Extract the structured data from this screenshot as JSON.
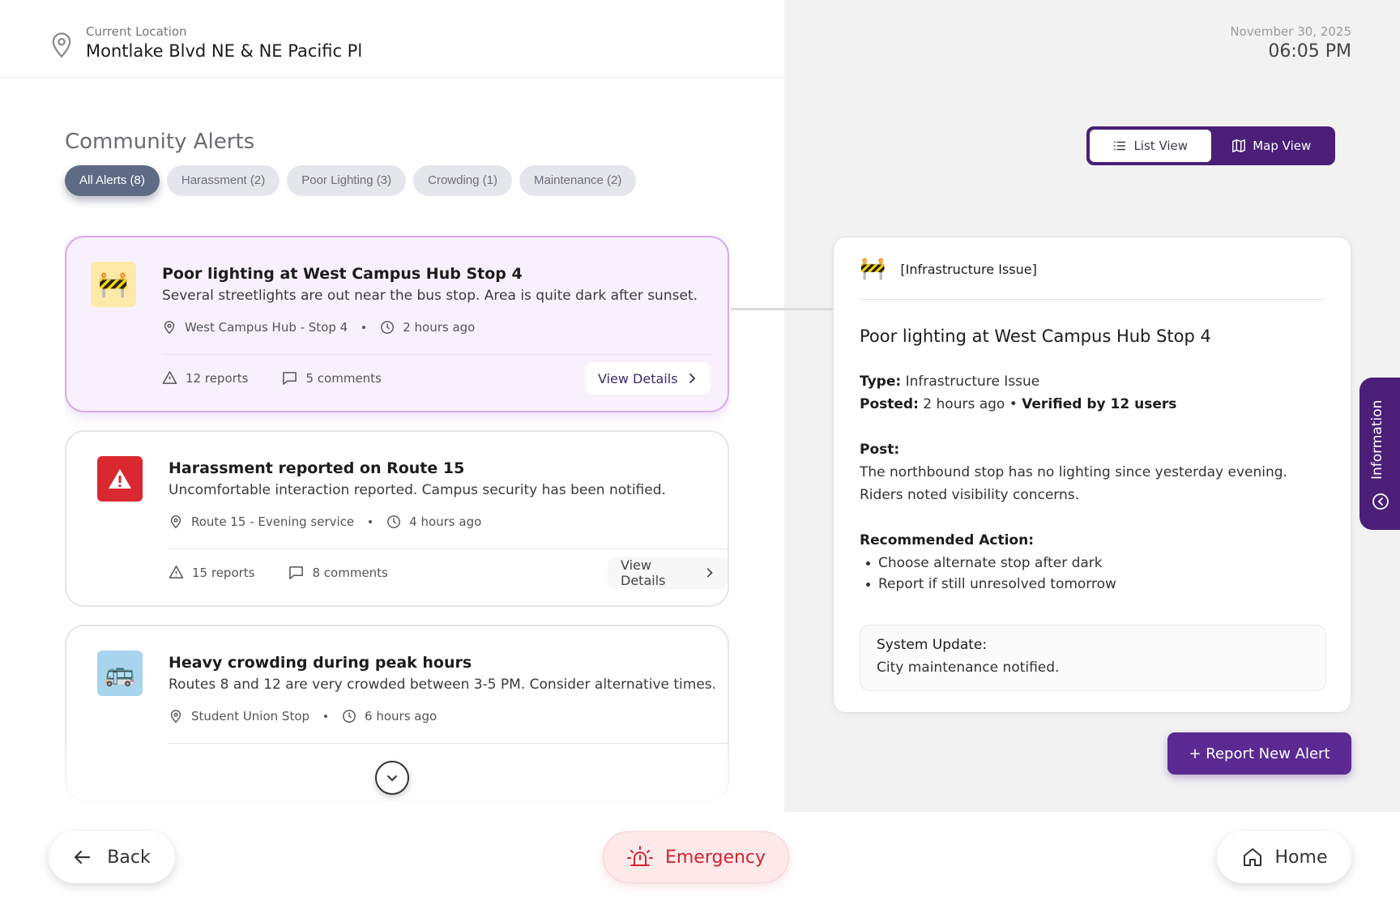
{
  "header": {
    "location_label": "Current Location",
    "location_value": "Montlake Blvd NE & NE Pacific Pl",
    "date": "November 30, 2025",
    "time": "06:05 PM"
  },
  "section_title": "Community Alerts",
  "filters": [
    {
      "label": "All Alerts (8)",
      "active": true
    },
    {
      "label": "Harassment (2)",
      "active": false
    },
    {
      "label": "Poor Lighting (3)",
      "active": false
    },
    {
      "label": "Crowding (1)",
      "active": false
    },
    {
      "label": "Maintenance (2)",
      "active": false
    }
  ],
  "view_toggle": {
    "list_label": "List View",
    "map_label": "Map View",
    "active": "list"
  },
  "alerts": [
    {
      "icon": "construction-barrier-icon",
      "emoji": "🚧",
      "title": "Poor lighting at West Campus Hub Stop 4",
      "description": "Several streetlights are out near the bus stop. Area is quite dark after sunset.",
      "location": "West Campus Hub - Stop 4",
      "time_ago": "2 hours ago",
      "reports": "12 reports",
      "comments": "5 comments",
      "details_label": "View Details",
      "selected": true
    },
    {
      "icon": "warning-triangle-icon",
      "emoji": "⚠️",
      "title": "Harassment reported on Route 15",
      "description": "Uncomfortable interaction reported. Campus security has been notified.",
      "location": "Route 15 - Evening service",
      "time_ago": "4 hours ago",
      "reports": "15 reports",
      "comments": "8 comments",
      "details_label": "View Details",
      "selected": false
    },
    {
      "icon": "bus-icon",
      "emoji": "🚌",
      "title": "Heavy crowding during peak hours",
      "description": "Routes 8 and 12 are very crowded between 3-5 PM. Consider alternative times.",
      "location": "Student Union Stop",
      "time_ago": "6 hours ago",
      "reports": "",
      "comments": "",
      "details_label": "",
      "selected": false
    }
  ],
  "detail": {
    "category_emoji": "🚧",
    "category": "[Infrastructure Issue]",
    "title": "Poor lighting at West Campus Hub Stop 4",
    "type_label": "Type:",
    "type_value": "Infrastructure Issue",
    "posted_label": "Posted:",
    "posted_value": "2 hours ago •",
    "verified": "Verified by 12 users",
    "post_label": "Post:",
    "post_line1": "The northbound stop has no lighting since yesterday evening.",
    "post_line2": "Riders noted visibility concerns.",
    "action_label": "Recommended Action:",
    "actions": [
      "Choose alternate stop after dark",
      "Report if still unresolved tomorrow"
    ],
    "system_label": "System Update:",
    "system_text": "City maintenance notified."
  },
  "report_button": "+ Report New Alert",
  "info_tab": "Information",
  "bottom": {
    "back": "Back",
    "emergency": "Emergency",
    "home": "Home"
  },
  "colors": {
    "brand_purple": "#4b1f78",
    "report_purple": "#5a2a92",
    "emergency_red": "#d1242f",
    "selected_card_bg": "#f8f1fd",
    "chip_active": "#5f6b85"
  }
}
